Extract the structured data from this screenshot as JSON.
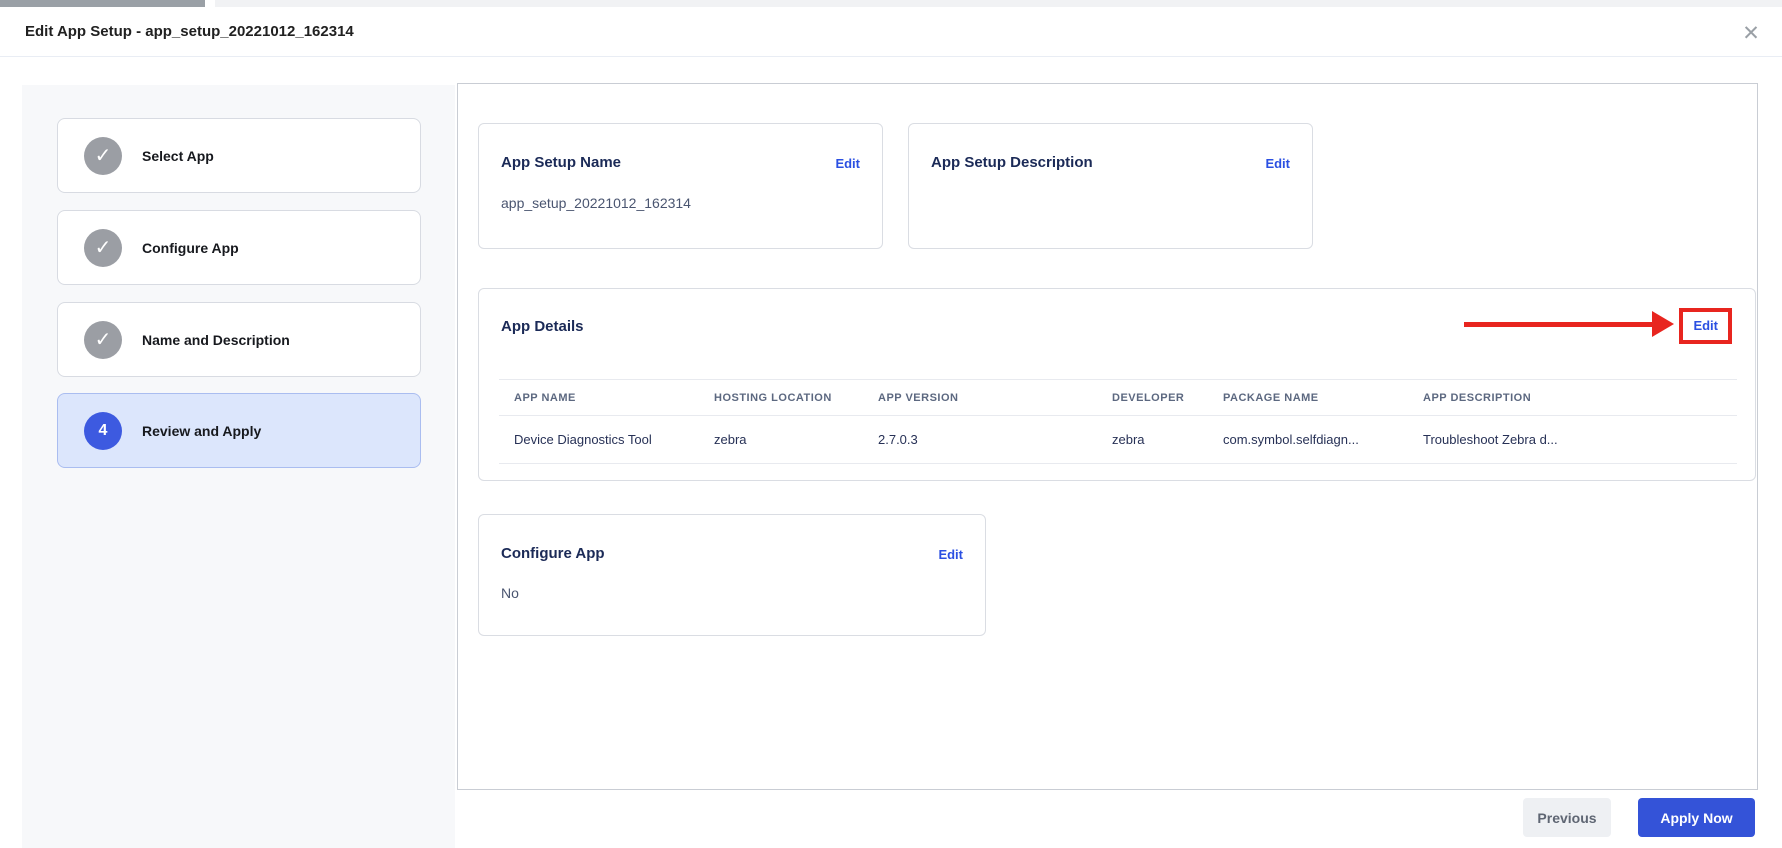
{
  "header": {
    "title": "Edit App Setup - app_setup_20221012_162314"
  },
  "icons": {
    "check": "✓",
    "close": "✕"
  },
  "wizard": {
    "steps": [
      {
        "label": "Select App",
        "status": "complete"
      },
      {
        "label": "Configure App",
        "status": "complete"
      },
      {
        "label": "Name and Description",
        "status": "complete"
      },
      {
        "label": "Review and Apply",
        "status": "active",
        "number": "4"
      }
    ]
  },
  "review": {
    "app_setup_name": {
      "title": "App Setup Name",
      "edit_label": "Edit",
      "value": "app_setup_20221012_162314"
    },
    "app_setup_description": {
      "title": "App Setup Description",
      "edit_label": "Edit",
      "value": ""
    },
    "app_details": {
      "title": "App Details",
      "edit_label": "Edit",
      "table": {
        "columns": [
          "APP NAME",
          "HOSTING LOCATION",
          "APP VERSION",
          "DEVELOPER",
          "PACKAGE NAME",
          "APP DESCRIPTION"
        ],
        "rows": [
          [
            "Device Diagnostics Tool",
            "zebra",
            "2.7.0.3",
            "zebra",
            "com.symbol.selfdiagn...",
            "Troubleshoot Zebra d..."
          ]
        ]
      }
    },
    "configure_app": {
      "title": "Configure App",
      "edit_label": "Edit",
      "value": "No"
    }
  },
  "footer": {
    "previous_label": "Previous",
    "apply_label": "Apply Now"
  },
  "colors": {
    "accent_blue": "#3d5ae0",
    "link_blue": "#2b50e2",
    "apply_button_blue": "#3453d8",
    "annotation_red": "#e8251f",
    "heading_navy": "#1b2a57",
    "step_active_bg": "#dce6fc",
    "sidebar_bg": "#f7f8fa"
  },
  "annotation": {
    "type": "red-arrow-highlight",
    "target": "app-details-edit-link"
  }
}
